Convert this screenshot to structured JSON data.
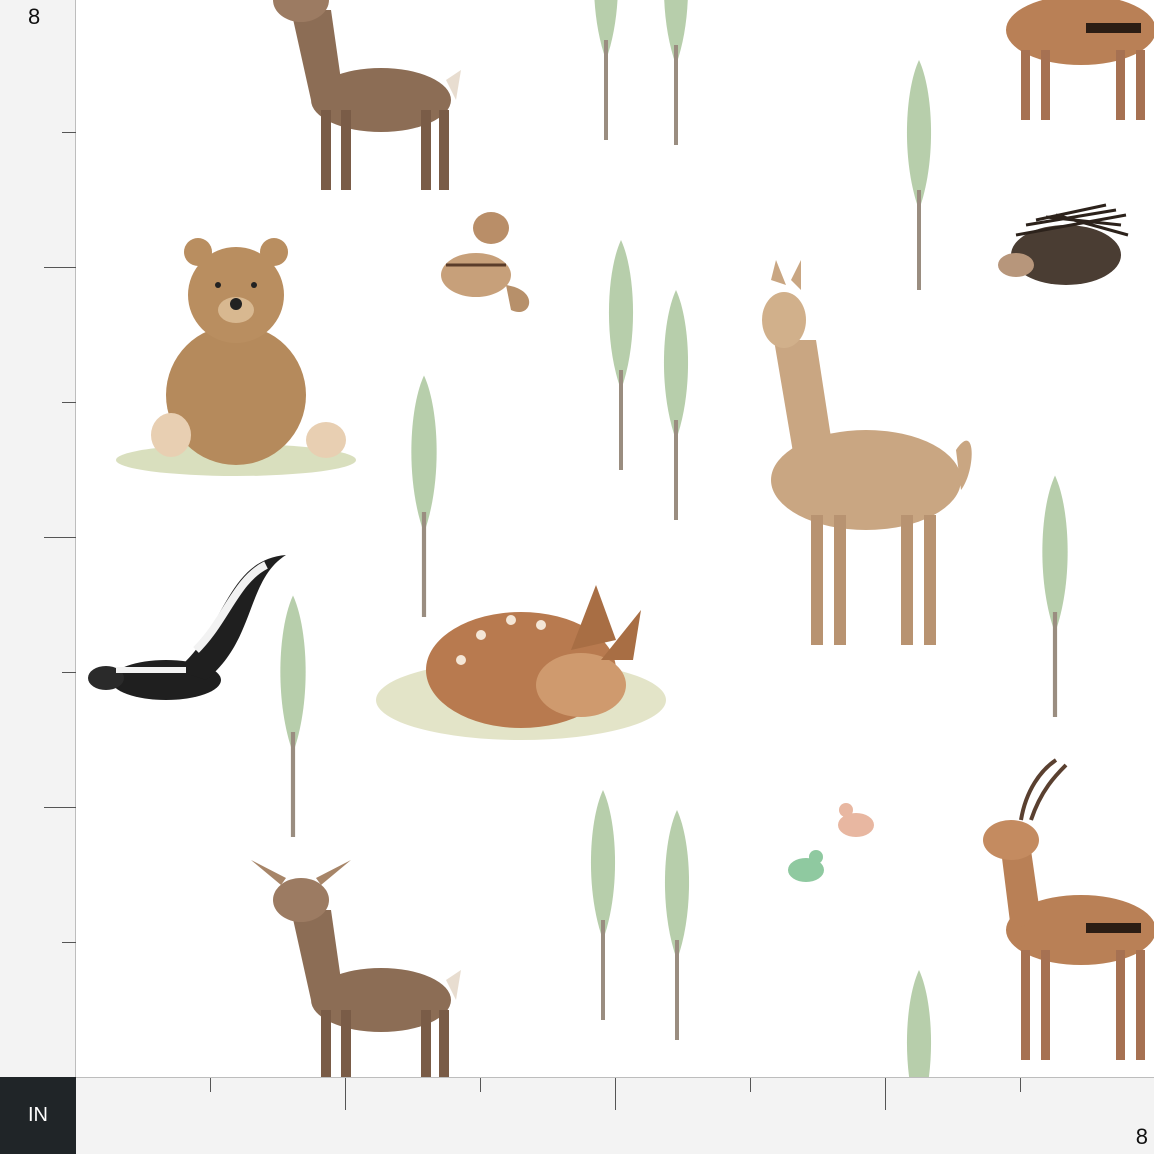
{
  "ruler": {
    "top_value": "8",
    "bottom_value": "8",
    "unit_label": "IN"
  },
  "colors": {
    "ruler_bg": "#f3f3f3",
    "unit_box_bg": "#202528",
    "tree_green": "#a9c49a",
    "tree_dark_green": "#93b092",
    "deer_brown": "#8c6d55",
    "bear_brown": "#b58a5c",
    "llama_tan": "#c9a682"
  },
  "pattern": {
    "elements": [
      "deer-icon",
      "tree-icon",
      "bear-icon",
      "chipmunk-icon",
      "llama-icon",
      "porcupine-icon",
      "skunk-icon",
      "fawn-icon",
      "birds-icon",
      "antelope-icon"
    ]
  }
}
